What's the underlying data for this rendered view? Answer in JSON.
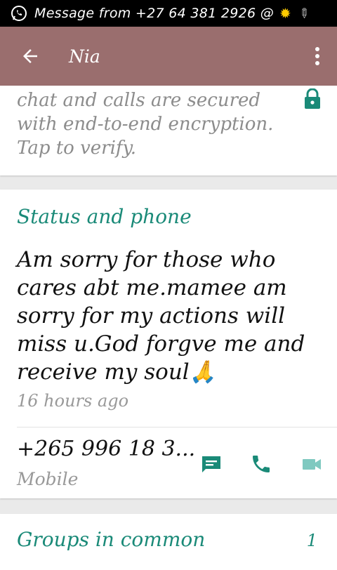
{
  "status_bar": {
    "notification_text": "Message from +27 64 381 2926 @",
    "icons": [
      "whatsapp-icon",
      "sun-icon",
      "pen-icon"
    ]
  },
  "app_bar": {
    "title": "Nia",
    "icons": [
      "back-arrow-icon",
      "more-vert-icon"
    ],
    "color": "#9a6e6e"
  },
  "encryption": {
    "text": "chat and calls are secured with end-to-end encryption. Tap to verify.",
    "icon": "lock-icon"
  },
  "status_section": {
    "heading": "Status and phone",
    "about": "Am sorry for those who cares abt me.mamee am sorry for my actions will miss u.God forgve me and receive my soul🙏",
    "time": "16 hours ago",
    "phone": "+265 996 18 3...",
    "phone_type": "Mobile",
    "action_icons": [
      "message-icon",
      "call-icon",
      "video-call-icon"
    ]
  },
  "groups_section": {
    "heading": "Groups in common",
    "count": "1"
  },
  "colors": {
    "accent": "#1a8a78",
    "muted": "#8c8c8c"
  }
}
